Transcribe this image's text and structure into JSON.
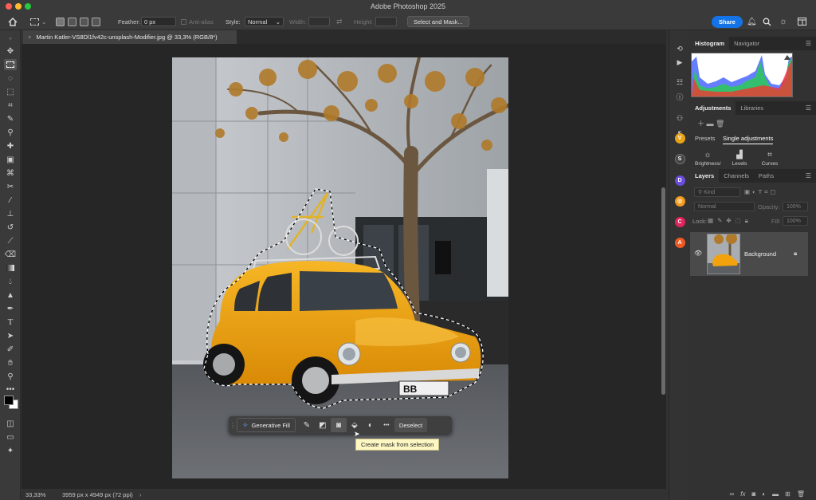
{
  "window": {
    "title": "Adobe Photoshop 2025"
  },
  "options_bar": {
    "feather_label": "Feather:",
    "feather_value": "0 px",
    "anti_alias_label": "Anti-alias",
    "style_label": "Style:",
    "style_value": "Normal",
    "width_label": "Width:",
    "height_label": "Height:",
    "select_mask_label": "Select and Mask...",
    "share_label": "Share"
  },
  "document": {
    "tab_title": "Martin Katler-VS8Dl1fv42c-unsplash-Modifier.jpg @ 33,3% (RGB/8*)",
    "plate_text": "BB"
  },
  "contextual_bar": {
    "generative_fill_label": "Generative Fill",
    "deselect_label": "Deselect",
    "more_label": "•••",
    "tooltip": "Create mask from selection"
  },
  "status": {
    "zoom": "33,33%",
    "doc_info": "3959 px x 4949 px (72 ppi)",
    "arrow": "›"
  },
  "panels": {
    "histogram_tab": "Histogram",
    "navigator_tab": "Navigator",
    "adjustments_tab": "Adjustments",
    "libraries_tab": "Libraries",
    "presets_label": "Presets",
    "single_adjustments_label": "Single adjustments",
    "adjustments": [
      "Brightness/",
      "Levels",
      "Curves"
    ],
    "layers_tab": "Layers",
    "channels_tab": "Channels",
    "paths_tab": "Paths",
    "kind_placeholder": "Kind",
    "blend_mode": "Normal",
    "opacity_label": "Opacity:",
    "opacity_value": "100%",
    "lock_label": "Lock:",
    "fill_label": "Fill:",
    "fill_value": "100%",
    "layer_name": "Background"
  },
  "icons": {
    "home": "home-icon",
    "bell": "bell-icon",
    "search": "search-icon",
    "lightbulb": "lightbulb-icon",
    "layout": "workspace-icon"
  },
  "colors": {
    "accent": "#1473e6",
    "car": "#f2a20c",
    "tooltip_bg": "#fdf7c3"
  }
}
